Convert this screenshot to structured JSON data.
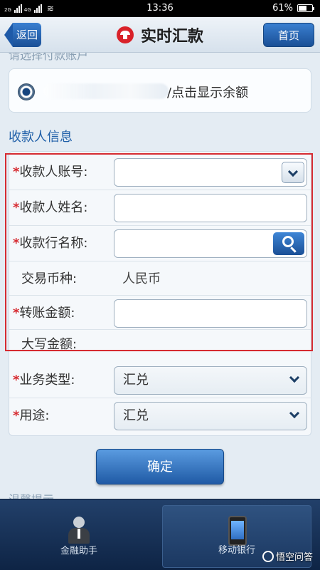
{
  "status_bar": {
    "signal_1": "2G",
    "signal_2": "4G",
    "time": "13:36",
    "battery_text": "61%",
    "battery_level": 0.61
  },
  "header": {
    "back_label": "返回",
    "title": "实时汇款",
    "home_label": "首页"
  },
  "payer": {
    "partial_heading": "请选择付款账户",
    "account_hint": "/点击显示余额"
  },
  "payee": {
    "section_title": "收款人信息",
    "account_label": "收款人账号:",
    "name_label": "收款人姓名:",
    "bank_label": "收款行名称:",
    "currency_label": "交易币种:",
    "currency_value": "人民币",
    "amount_label": "转账金额:",
    "amount_words_label": "大写金额:",
    "business_type_label": "业务类型:",
    "business_type_value": "汇兑",
    "purpose_label": "用途:",
    "purpose_value": "汇兑",
    "required_mark": "*"
  },
  "confirm_label": "确定",
  "partial_tip": "温馨提示",
  "bottom_nav": {
    "items": [
      {
        "label": "金融助手",
        "icon": "assistant-icon"
      },
      {
        "label": "移动银行",
        "icon": "mobile-phone-icon"
      }
    ]
  },
  "watermark": "悟空问答",
  "colors": {
    "accent_blue": "#1f5aa5",
    "required_red": "#d62b31",
    "nav_background": "#0e2445"
  }
}
